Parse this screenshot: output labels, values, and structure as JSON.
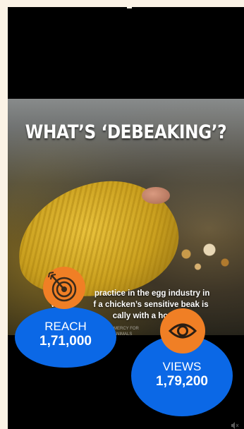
{
  "video": {
    "title": "WHAT’S ‘DEBEAKING’?",
    "caption_line1": "Deb             practice in the egg industry in",
    "caption_line2": "w                f a chicken’s sensitive beak is",
    "caption_line3": "                      cally with a hot blade.",
    "watermark_line1": "MERCY FOR",
    "watermark_line2": "ANIMALS",
    "mute_icon": "speaker-muted-icon"
  },
  "metrics": {
    "reach": {
      "label": "REACH",
      "value": "1,71,000",
      "icon": "target-icon"
    },
    "views": {
      "label": "VIEWS",
      "value": "1,79,200",
      "icon": "eye-icon"
    }
  },
  "colors": {
    "page_background": "#fbf3e6",
    "metric_blue": "#0b68e6",
    "badge_orange": "#f07f25",
    "frame_black": "#000000"
  }
}
